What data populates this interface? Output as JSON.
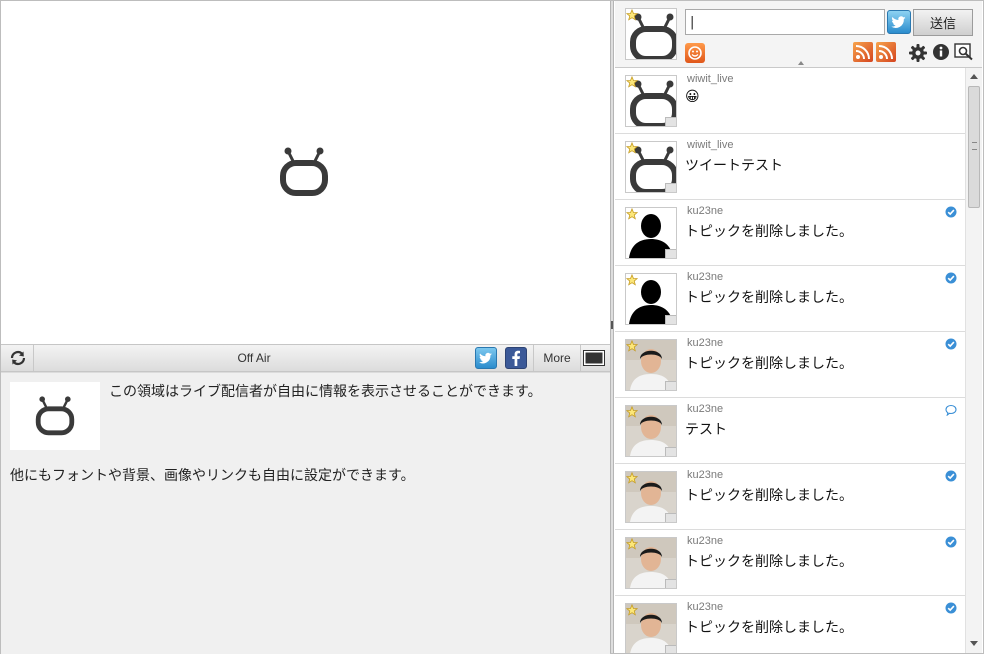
{
  "player": {
    "status_label": "Off Air",
    "more_label": "More",
    "logo_icon": "niconico-tv-icon"
  },
  "info": {
    "line1": "この領域はライブ配信者が自由に情報を表示させることができます。",
    "line2": "他にもフォントや背景、画像やリンクも自由に設定ができます。"
  },
  "composer": {
    "input_value": "|",
    "send_label": "送信"
  },
  "tweets": [
    {
      "user": "wiwit_live",
      "text": "😀",
      "avatar": "tv-logo",
      "badge": ""
    },
    {
      "user": "wiwit_live",
      "text": "ツイートテスト",
      "avatar": "tv-logo",
      "badge": ""
    },
    {
      "user": "ku23ne",
      "text": "トピックを削除しました。",
      "avatar": "silhouette",
      "badge": "check"
    },
    {
      "user": "ku23ne",
      "text": "トピックを削除しました。",
      "avatar": "silhouette",
      "badge": "check"
    },
    {
      "user": "ku23ne",
      "text": "トピックを削除しました。",
      "avatar": "photo",
      "badge": "check"
    },
    {
      "user": "ku23ne",
      "text": "テスト",
      "avatar": "photo",
      "badge": "reply"
    },
    {
      "user": "ku23ne",
      "text": "トピックを削除しました。",
      "avatar": "photo",
      "badge": "check"
    },
    {
      "user": "ku23ne",
      "text": "トピックを削除しました。",
      "avatar": "photo",
      "badge": "check"
    },
    {
      "user": "ku23ne",
      "text": "トピックを削除しました。",
      "avatar": "photo",
      "badge": "check"
    }
  ],
  "colors": {
    "twitter": "#2b8ccd",
    "facebook": "#3b5998",
    "badge_blue": "#3a8fd6"
  }
}
